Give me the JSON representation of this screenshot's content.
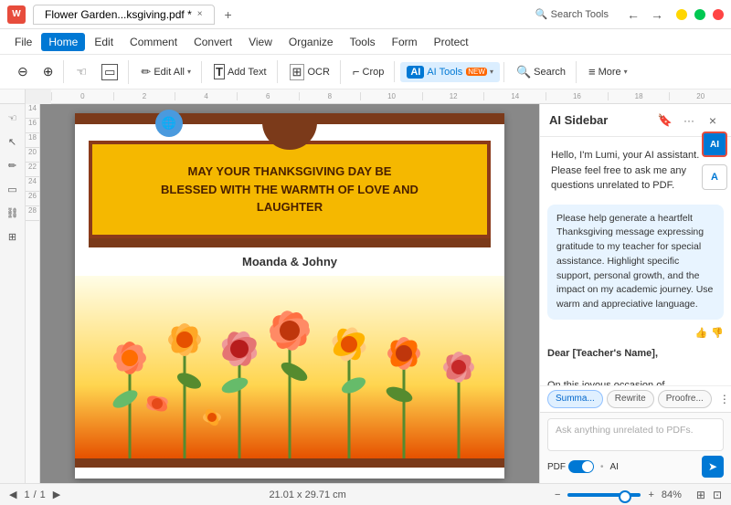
{
  "titlebar": {
    "app_icon": "W",
    "tab_title": "Flower Garden...ksgiving.pdf *",
    "close_tab": "×",
    "new_tab": "+",
    "win_title": ""
  },
  "menubar": {
    "items": [
      "File",
      "Home",
      "Edit",
      "Comment",
      "Convert",
      "View",
      "Organize",
      "Tools",
      "Form",
      "Protect"
    ]
  },
  "toolbar": {
    "home_active": true,
    "tools": [
      {
        "id": "zoom-out",
        "icon": "🔍",
        "label": ""
      },
      {
        "id": "zoom-in",
        "icon": "🔍",
        "label": ""
      },
      {
        "id": "hand",
        "icon": "✋",
        "label": ""
      },
      {
        "id": "select",
        "icon": "▭",
        "label": ""
      },
      {
        "id": "edit-all",
        "icon": "✏️",
        "label": "Edit All"
      },
      {
        "id": "add-text",
        "icon": "T",
        "label": "Add Text"
      },
      {
        "id": "ocr",
        "icon": "⊡",
        "label": "OCR"
      },
      {
        "id": "crop",
        "icon": "⌐",
        "label": "Crop"
      },
      {
        "id": "ai-tools",
        "icon": "AI",
        "label": "AI Tools"
      },
      {
        "id": "search",
        "icon": "🔍",
        "label": "Search"
      },
      {
        "id": "more",
        "icon": "≡",
        "label": "More"
      }
    ],
    "search_tools_label": "Search Tools"
  },
  "pdf": {
    "main_text_line1": "MAY YOUR THANKSGIVING DAY BE",
    "main_text_line2": "BLESSED WITH THE WARMTH OF LOVE AND",
    "main_text_line3": "LAUGHTER",
    "signature": "Moanda & Johny",
    "dimensions": "21.01 x 29.71 cm"
  },
  "ai_sidebar": {
    "title": "AI Sidebar",
    "intro_text": "Hello, I'm Lumi, your AI assistant. Please feel free to ask me any questions unrelated to PDF.",
    "user_message": "Please help generate a heartfelt Thanksgiving message expressing gratitude to my teacher for special assistance. Highlight specific support, personal growth, and the impact on my academic journey. Use warm and appreciative language.",
    "ai_response_line1": "Dear [Teacher's Name],",
    "ai_response_body": "On this joyous occasion of Thanksgiving, I wanted to take a moment to express my deepest gratitude for all the special assistance and unwavering support you have provided me throughout my",
    "action_tabs": [
      "Summa...",
      "Rewrite",
      "Proofre..."
    ],
    "input_placeholder": "Ask anything unrelated to PDFs.",
    "pdf_label": "PDF",
    "ai_label": "AI"
  },
  "statusbar": {
    "page_current": "1",
    "page_total": "1",
    "page_label": "/",
    "dimensions": "21.01 x 29.71 cm",
    "zoom": "84%"
  }
}
